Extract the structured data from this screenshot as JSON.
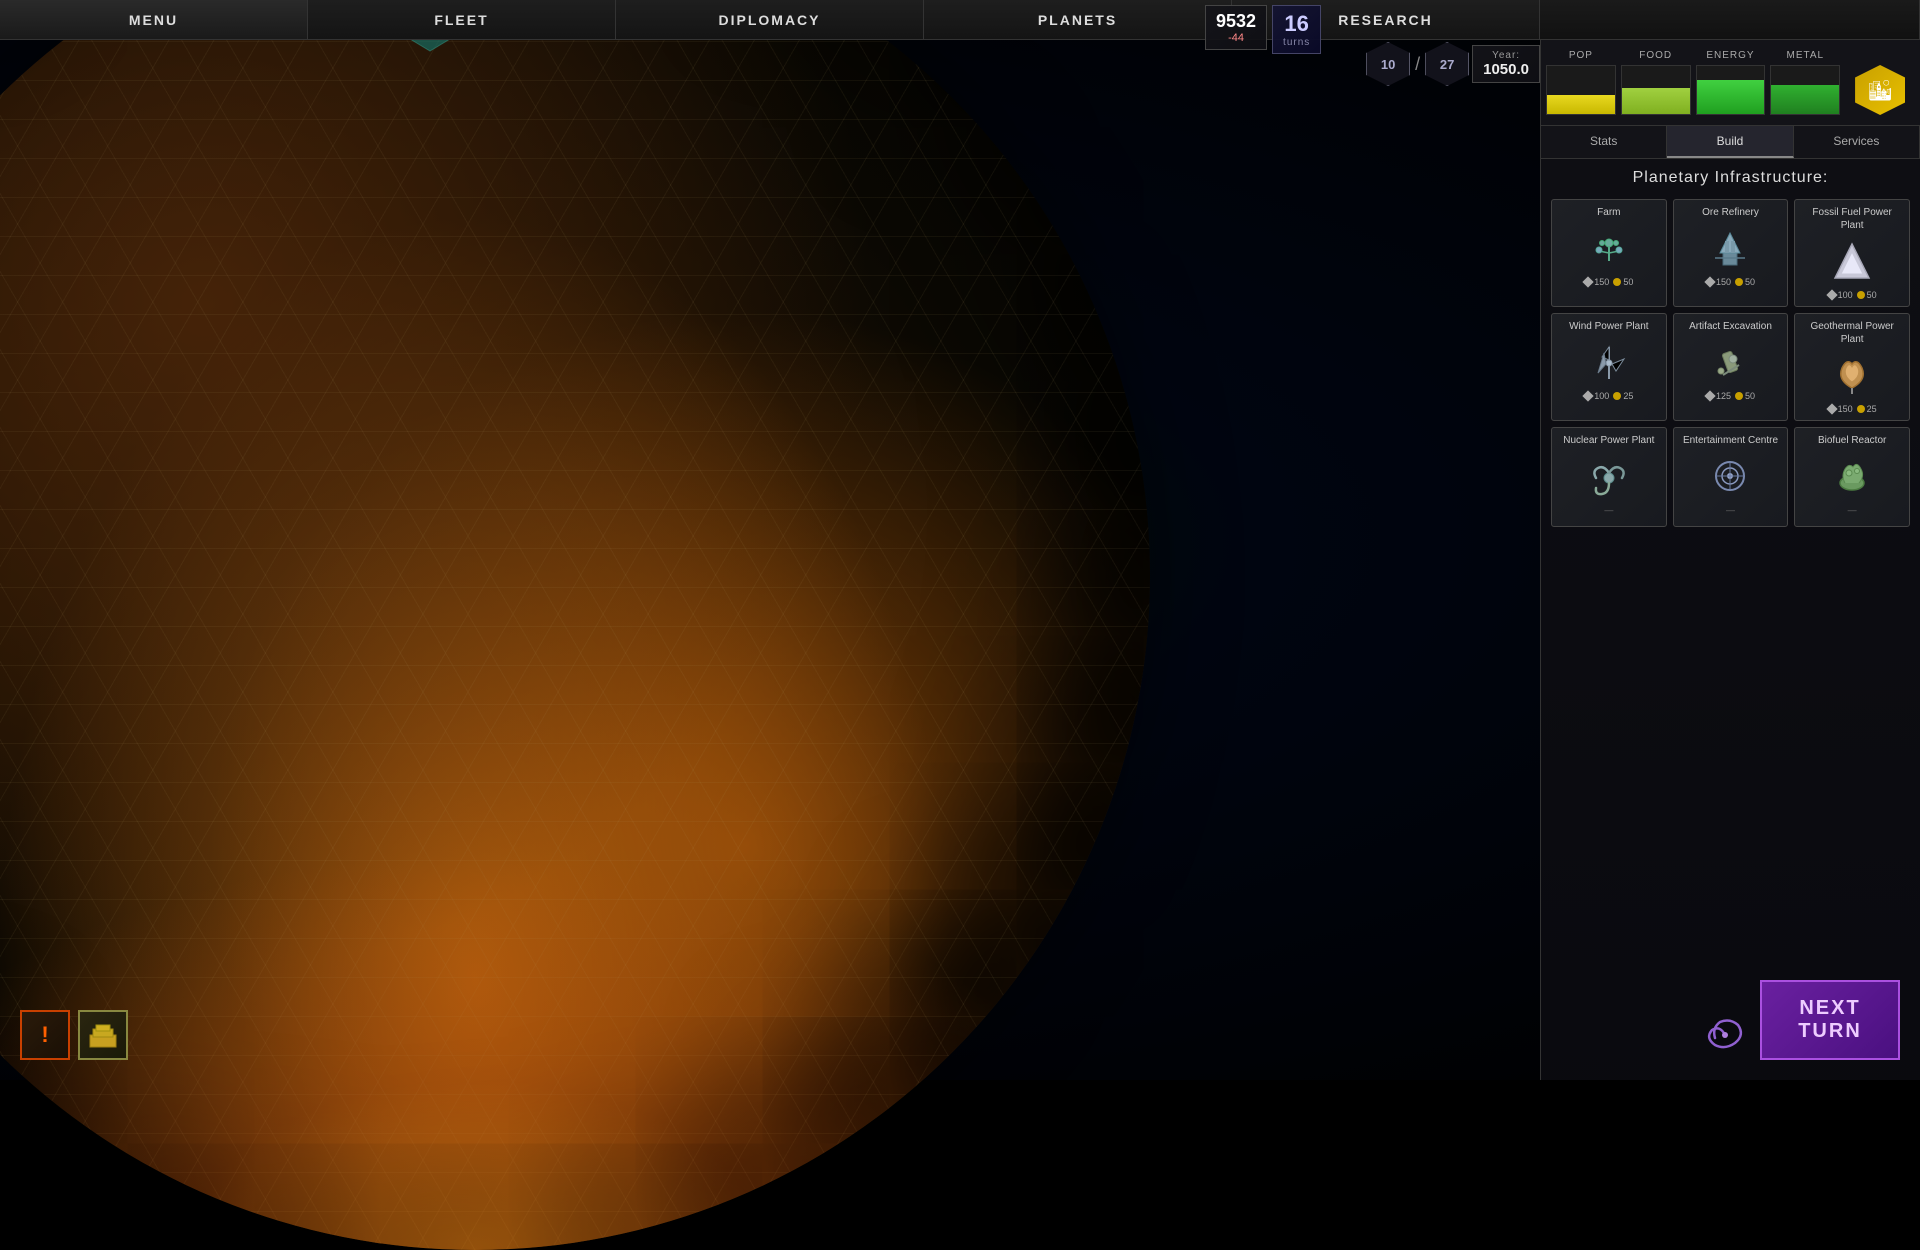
{
  "nav": {
    "items": [
      "MENU",
      "FLEET",
      "DIPLOMACY",
      "PLANETS",
      "RESEARCH"
    ]
  },
  "hud": {
    "credits": "9532",
    "credits_delta": "-44",
    "turns": "16",
    "turns_label": "turns",
    "hex_current": "10",
    "hex_max": "27",
    "year_label": "Year:",
    "year_value": "1050.0"
  },
  "resources": {
    "pop_label": "POP",
    "food_label": "FOOD",
    "energy_label": "ENERGY",
    "metal_label": "METAL"
  },
  "tabs": {
    "stats_label": "Stats",
    "build_label": "Build",
    "services_label": "Services",
    "active": "Build"
  },
  "panel": {
    "title": "Planetary Infrastructure:",
    "buildings": [
      {
        "name": "Farm",
        "icon": "🌿",
        "cost_mineral": 150,
        "cost_credits": 50
      },
      {
        "name": "Ore Refinery",
        "icon": "⚙",
        "cost_mineral": 150,
        "cost_credits": 50
      },
      {
        "name": "Fossil Fuel Power Plant",
        "icon": "🔷",
        "cost_mineral": 100,
        "cost_credits": 50
      },
      {
        "name": "Wind Power Plant",
        "icon": "✳",
        "cost_mineral": 100,
        "cost_credits": 25
      },
      {
        "name": "Artifact Excavation",
        "icon": "🔩",
        "cost_mineral": 125,
        "cost_credits": 50
      },
      {
        "name": "Geothermal Power Plant",
        "icon": "🦂",
        "cost_mineral": 150,
        "cost_credits": 25
      },
      {
        "name": "Nuclear Power Plant",
        "icon": "☢",
        "cost_mineral": null,
        "cost_credits": null
      },
      {
        "name": "Entertainment Centre",
        "icon": "🔵",
        "cost_mineral": null,
        "cost_credits": null
      },
      {
        "name": "Biofuel Reactor",
        "icon": "🐛",
        "cost_mineral": null,
        "cost_credits": null
      }
    ]
  },
  "bottom_left": {
    "alert_icon": "!",
    "build_icon": "🏛"
  },
  "next_turn": {
    "line1": "NEXT",
    "line2": "TURN"
  }
}
